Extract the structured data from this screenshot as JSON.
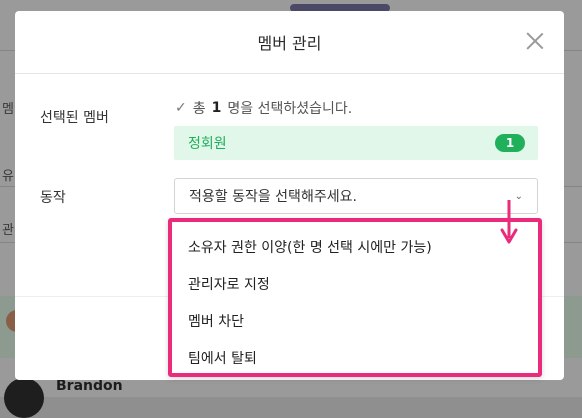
{
  "background": {
    "fragments": [
      "멤",
      "유",
      "관",
      "B"
    ],
    "member_name": "Brandon"
  },
  "modal": {
    "title": "멤버 관리",
    "selected_members_label": "선택된 멤버",
    "selected_summary": {
      "prefix": "총",
      "count": "1",
      "suffix": "명을 선택하셨습니다."
    },
    "member_group": {
      "label": "정회원",
      "count": "1"
    },
    "action_label": "동작",
    "action_select": {
      "placeholder": "적용할 동작을 선택해주세요."
    }
  },
  "dropdown": {
    "items": [
      "소유자 권한 이양(한 명 선택 시에만 가능)",
      "관리자로 지정",
      "멤버 차단",
      "팀에서 탈퇴"
    ]
  },
  "colors": {
    "accent_green": "#20b05c",
    "highlight_pink": "#ea2a7b",
    "pill_bg": "#e1f7e9"
  },
  "icons": [
    "close-icon",
    "check-icon",
    "chevron-down-icon",
    "arrow-down-icon"
  ]
}
